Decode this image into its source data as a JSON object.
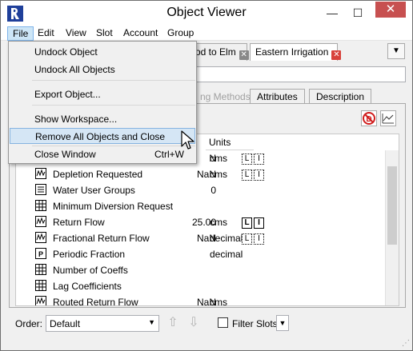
{
  "window": {
    "title": "Object Viewer",
    "minimize": "—",
    "maximize": "☐",
    "close": "✕"
  },
  "menubar": {
    "items": [
      "File",
      "Edit",
      "View",
      "Slot",
      "Account",
      "Group"
    ]
  },
  "object_tabs": [
    {
      "label": "od to Elm",
      "selected": false
    },
    {
      "label": "Eastern Irrigation",
      "selected": true
    }
  ],
  "sub_tabs": {
    "methods": "ng Methods",
    "attributes": "Attributes",
    "description": "Description"
  },
  "table": {
    "units_header": "Units",
    "rows": [
      {
        "name": "",
        "value": "N",
        "unit": "cms",
        "flags": [
          "L",
          "I"
        ],
        "flag_style": "dotted",
        "icon": "series-icon"
      },
      {
        "name": "Depletion Requested",
        "value": "NaN",
        "unit": "cms",
        "flags": [
          "L",
          "I"
        ],
        "flag_style": "dotted",
        "icon": "series-icon"
      },
      {
        "name": "Water User Groups",
        "value": "0",
        "unit": "",
        "flags": [],
        "flag_style": "",
        "icon": "list-icon"
      },
      {
        "name": "Minimum Diversion Request",
        "value": "",
        "unit": "",
        "flags": [],
        "flag_style": "",
        "icon": "table-icon"
      },
      {
        "name": "Return Flow",
        "value": "25.00",
        "unit": "cms",
        "flags": [
          "L",
          "I"
        ],
        "flag_style": "solid",
        "icon": "series-icon"
      },
      {
        "name": "Fractional Return Flow",
        "value": "NaN",
        "unit": "decimal",
        "flags": [
          "L",
          "I"
        ],
        "flag_style": "dotted",
        "icon": "series-icon"
      },
      {
        "name": "Periodic Fraction",
        "value": "",
        "unit": "decimal",
        "flags": [],
        "flag_style": "",
        "icon": "periodic-icon"
      },
      {
        "name": "Number of Coeffs",
        "value": "",
        "unit": "",
        "flags": [],
        "flag_style": "",
        "icon": "table-icon"
      },
      {
        "name": "Lag Coefficients",
        "value": "",
        "unit": "",
        "flags": [],
        "flag_style": "",
        "icon": "table-icon"
      },
      {
        "name": "Routed Return Flow",
        "value": "NaN",
        "unit": "cms",
        "flags": [],
        "flag_style": "",
        "icon": "series-icon"
      }
    ]
  },
  "footer": {
    "order_label": "Order:",
    "order_value": "Default",
    "filter_label": "Filter Slots"
  },
  "file_menu": {
    "items": [
      {
        "label": "Undock Object",
        "shortcut": ""
      },
      {
        "label": "Undock All Objects",
        "shortcut": ""
      },
      {
        "label": "Export Object...",
        "shortcut": ""
      },
      {
        "label": "Show Workspace...",
        "shortcut": ""
      },
      {
        "label": "Remove All Objects and Close",
        "shortcut": ""
      },
      {
        "label": "Close Window",
        "shortcut": "Ctrl+W"
      }
    ],
    "highlighted_item": "Remove All Objects and Close"
  },
  "colors": {
    "close_button": "#c75050",
    "menu_highlight": "#d5e6f5",
    "tab_close_red": "#d8413b"
  }
}
